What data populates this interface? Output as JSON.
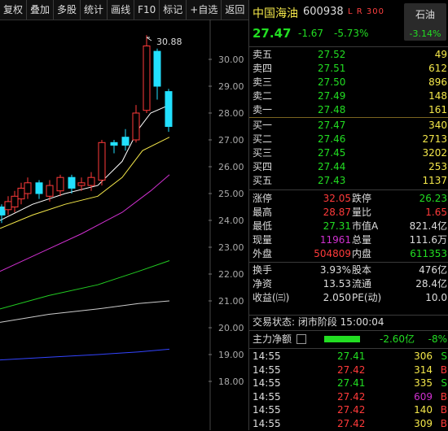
{
  "toolbar": {
    "items": [
      "复权",
      "叠加",
      "多股",
      "统计",
      "画线",
      "F10",
      "标记",
      "+自选",
      "返回"
    ]
  },
  "chart": {
    "y_ticks": [
      "30.00",
      "29.00",
      "28.00",
      "27.00",
      "26.00",
      "25.00",
      "24.00",
      "23.00",
      "22.00",
      "21.00",
      "20.00",
      "19.00",
      "18.00"
    ],
    "high_label": "30.88",
    "colors": {
      "up": "#ff3a3a",
      "down": "#22e0ff",
      "ma5": "#ffffff",
      "ma10": "#f5e84a",
      "ma20": "#d030d0",
      "ma30": "#22cc22",
      "ma60": "#cccccc",
      "ma120": "#3344ff"
    }
  },
  "header": {
    "name": "中国海油",
    "code": "600938",
    "tags": "L R 300",
    "sector_name": "石油",
    "sector_pct": "-3.14%",
    "price": "27.47",
    "change": "-1.67",
    "change_pct": "-5.73%"
  },
  "asks": [
    {
      "label": "卖五",
      "price": "27.52",
      "vol": "49"
    },
    {
      "label": "卖四",
      "price": "27.51",
      "vol": "612"
    },
    {
      "label": "卖三",
      "price": "27.50",
      "vol": "896"
    },
    {
      "label": "卖二",
      "price": "27.49",
      "vol": "148"
    },
    {
      "label": "卖一",
      "price": "27.48",
      "vol": "161"
    }
  ],
  "bids": [
    {
      "label": "买一",
      "price": "27.47",
      "vol": "340"
    },
    {
      "label": "买二",
      "price": "27.46",
      "vol": "2713"
    },
    {
      "label": "买三",
      "price": "27.45",
      "vol": "3202"
    },
    {
      "label": "买四",
      "price": "27.44",
      "vol": "253"
    },
    {
      "label": "买五",
      "price": "27.43",
      "vol": "1137"
    }
  ],
  "stats": {
    "limit_up_label": "涨停",
    "limit_up": "32.05",
    "limit_down_label": "跌停",
    "limit_down": "26.23",
    "high_label": "最高",
    "high": "28.87",
    "vol_ratio_label": "量比",
    "vol_ratio": "1.65",
    "low_label": "最低",
    "low": "27.31",
    "mktcap_label": "市值A",
    "mktcap": "821.4亿",
    "last_vol_label": "现量",
    "last_vol": "11961",
    "total_vol_label": "总量",
    "total_vol": "111.6万",
    "outer_label": "外盘",
    "outer": "504809",
    "inner_label": "内盘",
    "inner": "611353",
    "turnover_label": "换手",
    "turnover": "3.93%",
    "equity_label": "股本",
    "equity": "476亿",
    "net_asset_label": "净资",
    "net_asset": "13.53",
    "float_label": "流通",
    "float": "28.4亿",
    "eps_label": "收益(㈢)",
    "eps": "2.050",
    "pe_label": "PE(动)",
    "pe": "10.0"
  },
  "status": "交易状态: 闭市阶段 15:00:04",
  "flow": {
    "label": "主力净额",
    "value": "-2.60亿",
    "pct": "-8%"
  },
  "ticks": [
    {
      "time": "14:55",
      "price": "27.41",
      "vol": "306",
      "side": "S"
    },
    {
      "time": "14:55",
      "price": "27.42",
      "vol": "314",
      "side": "B"
    },
    {
      "time": "14:55",
      "price": "27.41",
      "vol": "335",
      "side": "S"
    },
    {
      "time": "14:55",
      "price": "27.42",
      "vol": "609",
      "side": "B"
    },
    {
      "time": "14:55",
      "price": "27.42",
      "vol": "140",
      "side": "B"
    },
    {
      "time": "14:55",
      "price": "27.42",
      "vol": "309",
      "side": "B"
    }
  ]
}
